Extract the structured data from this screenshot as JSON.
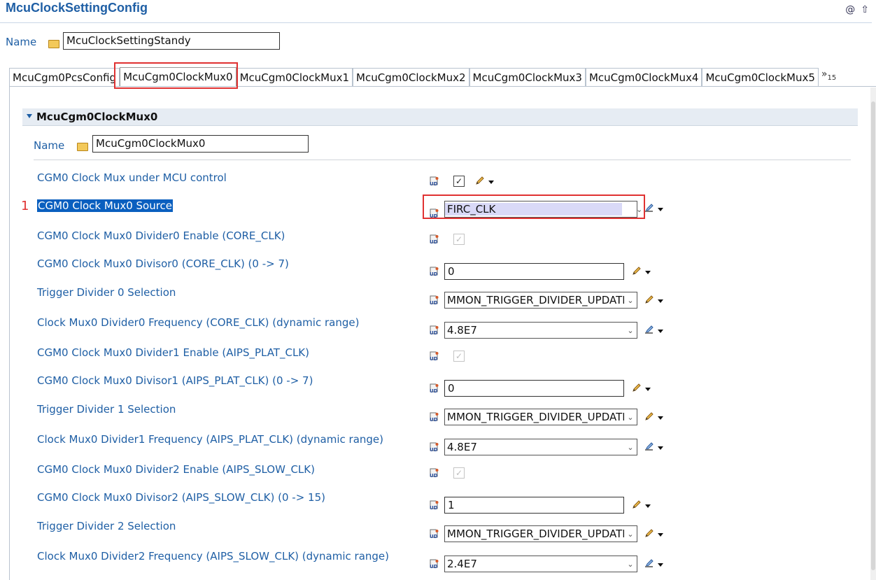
{
  "header": {
    "title": "McuClockSettingConfig",
    "at_icon": "@",
    "up_icon": "⇧"
  },
  "config": {
    "name_label": "Name",
    "name_value": "McuClockSettingStandy"
  },
  "tabs": [
    {
      "label": "McuCgm0PcsConfig"
    },
    {
      "label": "McuCgm0ClockMux0"
    },
    {
      "label": "McuCgm0ClockMux1"
    },
    {
      "label": "McuCgm0ClockMux2"
    },
    {
      "label": "McuCgm0ClockMux3"
    },
    {
      "label": "McuCgm0ClockMux4"
    },
    {
      "label": "McuCgm0ClockMux5"
    }
  ],
  "tab_overflow": {
    "arrows": "»",
    "count": "15"
  },
  "section": {
    "title": "McuCgm0ClockMux0",
    "name_label": "Name",
    "name_value": "McuCgm0ClockMux0"
  },
  "annotation": {
    "marker": "1"
  },
  "params": [
    {
      "label": "CGM0 Clock Mux under MCU control",
      "kind": "checkbox",
      "checked": true,
      "enabled": true,
      "icon": "pencil-icon"
    },
    {
      "label": "CGM0 Clock Mux0 Source",
      "kind": "combo",
      "value": "FIRC_CLK",
      "icon": "formula-icon",
      "highlight": true
    },
    {
      "label": "CGM0 Clock Mux0 Divider0 Enable (CORE_CLK)",
      "kind": "checkbox",
      "checked": true,
      "enabled": false
    },
    {
      "label": "CGM0 Clock Mux0 Divisor0 (CORE_CLK) (0 -> 7)",
      "kind": "text",
      "value": "0",
      "icon": "pencil-icon"
    },
    {
      "label": "Trigger Divider 0 Selection",
      "kind": "combo",
      "value": "MMON_TRIGGER_DIVIDER_UPDATE",
      "icon": "pencil-icon"
    },
    {
      "label": "Clock Mux0 Divider0 Frequency (CORE_CLK) (dynamic range)",
      "kind": "combo",
      "value": "4.8E7",
      "icon": "formula-icon"
    },
    {
      "label": "CGM0 Clock Mux0 Divider1 Enable (AIPS_PLAT_CLK)",
      "kind": "checkbox",
      "checked": true,
      "enabled": false
    },
    {
      "label": "CGM0 Clock Mux0 Divisor1 (AIPS_PLAT_CLK) (0 -> 7)",
      "kind": "text",
      "value": "0",
      "icon": "pencil-icon"
    },
    {
      "label": "Trigger Divider 1 Selection",
      "kind": "combo",
      "value": "MMON_TRIGGER_DIVIDER_UPDATE",
      "icon": "pencil-icon"
    },
    {
      "label": "Clock Mux0 Divider1 Frequency (AIPS_PLAT_CLK) (dynamic range)",
      "kind": "combo",
      "value": "4.8E7",
      "icon": "formula-icon"
    },
    {
      "label": "CGM0 Clock Mux0 Divider2 Enable (AIPS_SLOW_CLK)",
      "kind": "checkbox",
      "checked": true,
      "enabled": false
    },
    {
      "label": "CGM0 Clock Mux0 Divisor2 (AIPS_SLOW_CLK) (0 -> 15)",
      "kind": "text",
      "value": "1",
      "icon": "pencil-icon"
    },
    {
      "label": "Trigger Divider 2 Selection",
      "kind": "combo",
      "value": "MMON_TRIGGER_DIVIDER_UPDATE",
      "icon": "pencil-icon"
    },
    {
      "label": "Clock Mux0 Divider2 Frequency (AIPS_SLOW_CLK) (dynamic range)",
      "kind": "combo",
      "value": "2.4E7",
      "icon": "formula-icon"
    }
  ],
  "colors": {
    "accent": "#1f5fa5",
    "highlight_box": "#e03232",
    "selection": "#0a5fbf",
    "combo_selected_bg": "#d9d9f7"
  }
}
